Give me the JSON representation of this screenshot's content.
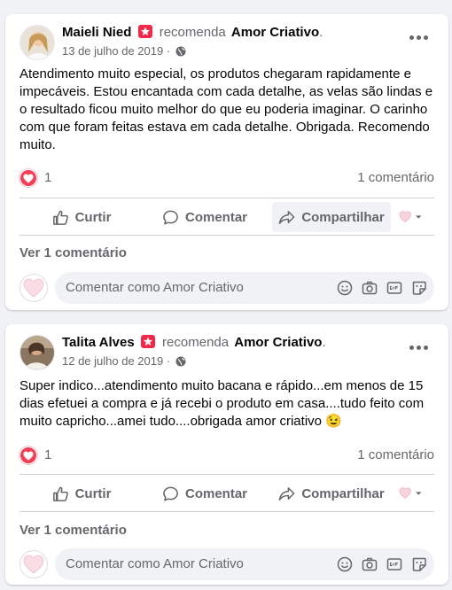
{
  "posts": [
    {
      "author": "Maieli Nied",
      "action": "recomenda",
      "page": "Amor Criativo",
      "date": "13 de julho de 2019 ·",
      "text": "Atendimento muito especial, os produtos chegaram rapidamente e impecáveis. Estou encantada com cada detalhe, as velas são lindas e o resultado ficou muito melhor do que eu poderia imaginar. O carinho com que foram feitas estava em cada detalhe. Obrigada. Recomendo muito.",
      "reaction_count": "1",
      "comment_count": "1 comentário",
      "like_label": "Curtir",
      "comment_label": "Comentar",
      "share_label": "Compartilhar",
      "see_comments": "Ver 1 comentário",
      "comment_placeholder": "Comentar como Amor Criativo"
    },
    {
      "author": "Talita Alves",
      "action": "recomenda",
      "page": "Amor Criativo",
      "date": "12 de julho de 2019 ·",
      "text": "Super indico...atendimento muito bacana e rápido...em menos de 15 dias efetuei a compra e já recebi o produto em casa....tudo feito com muito capricho...amei tudo....obrigada amor criativo 😉",
      "reaction_count": "1",
      "comment_count": "1 comentário",
      "like_label": "Curtir",
      "comment_label": "Comentar",
      "share_label": "Compartilhar",
      "see_comments": "Ver 1 comentário",
      "comment_placeholder": "Comentar como Amor Criativo"
    }
  ],
  "icons": {
    "recommend_badge": "recommend-badge-icon",
    "privacy": "globe-icon",
    "more": "more-options-icon",
    "reaction": "love-reaction-icon",
    "like": "thumbs-up-icon",
    "comment": "speech-bubble-icon",
    "share": "share-arrow-icon",
    "comment_tools": [
      "emoji-icon",
      "camera-icon",
      "gif-icon",
      "sticker-icon"
    ]
  },
  "colors": {
    "background": "#f0f2f5",
    "secondary_text": "#65676b",
    "love": "#f33e58",
    "badge": "#f02849",
    "divider": "#ced0d4"
  }
}
